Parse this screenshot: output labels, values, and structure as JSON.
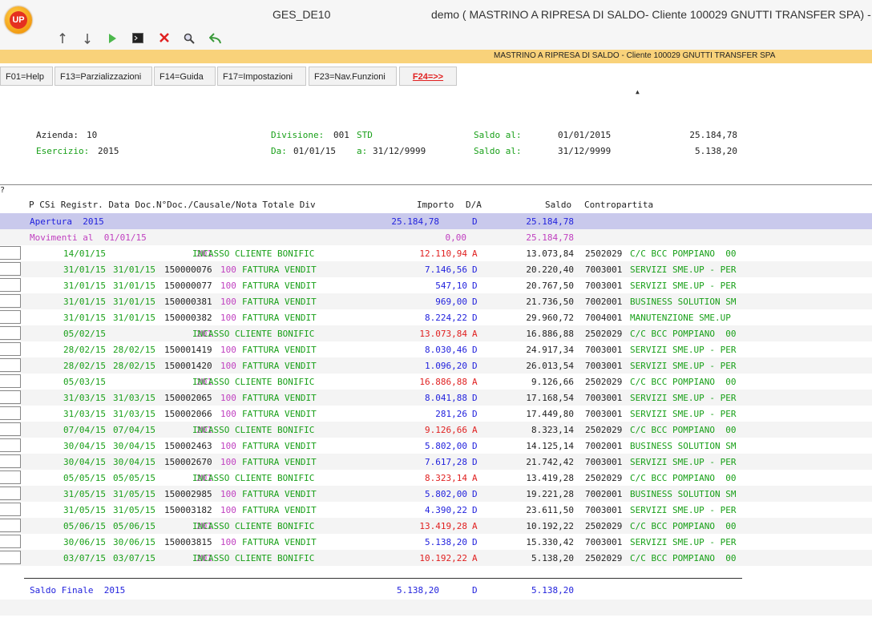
{
  "titlebar": {
    "logo_text": "UP",
    "app_name": "GES_DE10",
    "window_title": "demo ( MASTRINO A RIPRESA DI SALDO- Cliente 100029 GNUTTI TRANSFER SPA) -"
  },
  "toolbar": {
    "icons": [
      "arrow-up-icon",
      "arrow-down-icon",
      "play-icon",
      "terminal-icon",
      "delete-icon",
      "search-icon",
      "back-icon"
    ]
  },
  "subtitle": "MASTRINO A RIPRESA DI SALDO -  Cliente 100029 GNUTTI TRANSFER SPA",
  "fkeys": [
    {
      "label": "F01=Help"
    },
    {
      "label": "F13=Parzializzazioni"
    },
    {
      "label": "F14=Guida"
    },
    {
      "label": "F17=Impostazioni"
    },
    {
      "label": "F23=Nav.Funzioni"
    },
    {
      "label": "F24=>>"
    }
  ],
  "header": {
    "azienda_label": "Azienda:",
    "azienda_value": "10",
    "esercizio_label": "Esercizio:",
    "esercizio_value": "2015",
    "divisione_label": "Divisione:",
    "divisione_value": "001",
    "divisione_desc": "STD",
    "da_label": "Da:",
    "da_value": "01/01/15",
    "a_label": "a:",
    "a_value": "31/12/9999",
    "saldo1_label": "Saldo al:",
    "saldo1_date": "01/01/2015",
    "saldo1_value": "25.184,78",
    "saldo2_label": "Saldo al:",
    "saldo2_date": "31/12/9999",
    "saldo2_value": "5.138,20"
  },
  "table": {
    "qmark": "?",
    "columns": {
      "main": "P CSi Registr. Data Doc.N°Doc./Causale/Nota Totale Div",
      "importo": "Importo",
      "da": "D/A",
      "saldo": "Saldo",
      "contropartita": "Contropartita"
    },
    "apertura": {
      "label": "Apertura  2015",
      "importo": "25.184,78",
      "da": "D",
      "saldo": "25.184,78"
    },
    "movimenti": {
      "label": "Movimenti al  01/01/15",
      "importo": "0,00",
      "saldo": "25.184,78"
    },
    "rows": [
      {
        "reg": "14/01/15",
        "data_doc": "",
        "ndoc": "",
        "caus": "201",
        "desc": "INCASSO CLIENTE BONIFIC",
        "importo": "12.110,94",
        "da": "A",
        "saldo": "13.073,84",
        "conto": "2502029",
        "conto_desc": "C/C BCC POMPIANO  00"
      },
      {
        "reg": "31/01/15",
        "data_doc": "31/01/15",
        "ndoc": "150000076",
        "caus": "100",
        "desc": "FATTURA VENDIT",
        "importo": "7.146,56",
        "da": "D",
        "saldo": "20.220,40",
        "conto": "7003001",
        "conto_desc": "SERVIZI SME.UP - PER"
      },
      {
        "reg": "31/01/15",
        "data_doc": "31/01/15",
        "ndoc": "150000077",
        "caus": "100",
        "desc": "FATTURA VENDIT",
        "importo": "547,10",
        "da": "D",
        "saldo": "20.767,50",
        "conto": "7003001",
        "conto_desc": "SERVIZI SME.UP - PER"
      },
      {
        "reg": "31/01/15",
        "data_doc": "31/01/15",
        "ndoc": "150000381",
        "caus": "100",
        "desc": "FATTURA VENDIT",
        "importo": "969,00",
        "da": "D",
        "saldo": "21.736,50",
        "conto": "7002001",
        "conto_desc": "BUSINESS SOLUTION SM"
      },
      {
        "reg": "31/01/15",
        "data_doc": "31/01/15",
        "ndoc": "150000382",
        "caus": "100",
        "desc": "FATTURA VENDIT",
        "importo": "8.224,22",
        "da": "D",
        "saldo": "29.960,72",
        "conto": "7004001",
        "conto_desc": "MANUTENZIONE SME.UP"
      },
      {
        "reg": "05/02/15",
        "data_doc": "",
        "ndoc": "",
        "caus": "201",
        "desc": "INCASSO CLIENTE BONIFIC",
        "importo": "13.073,84",
        "da": "A",
        "saldo": "16.886,88",
        "conto": "2502029",
        "conto_desc": "C/C BCC POMPIANO  00"
      },
      {
        "reg": "28/02/15",
        "data_doc": "28/02/15",
        "ndoc": "150001419",
        "caus": "100",
        "desc": "FATTURA VENDIT",
        "importo": "8.030,46",
        "da": "D",
        "saldo": "24.917,34",
        "conto": "7003001",
        "conto_desc": "SERVIZI SME.UP - PER"
      },
      {
        "reg": "28/02/15",
        "data_doc": "28/02/15",
        "ndoc": "150001420",
        "caus": "100",
        "desc": "FATTURA VENDIT",
        "importo": "1.096,20",
        "da": "D",
        "saldo": "26.013,54",
        "conto": "7003001",
        "conto_desc": "SERVIZI SME.UP - PER"
      },
      {
        "reg": "05/03/15",
        "data_doc": "",
        "ndoc": "",
        "caus": "201",
        "desc": "INCASSO CLIENTE BONIFIC",
        "importo": "16.886,88",
        "da": "A",
        "saldo": "9.126,66",
        "conto": "2502029",
        "conto_desc": "C/C BCC POMPIANO  00"
      },
      {
        "reg": "31/03/15",
        "data_doc": "31/03/15",
        "ndoc": "150002065",
        "caus": "100",
        "desc": "FATTURA VENDIT",
        "importo": "8.041,88",
        "da": "D",
        "saldo": "17.168,54",
        "conto": "7003001",
        "conto_desc": "SERVIZI SME.UP - PER"
      },
      {
        "reg": "31/03/15",
        "data_doc": "31/03/15",
        "ndoc": "150002066",
        "caus": "100",
        "desc": "FATTURA VENDIT",
        "importo": "281,26",
        "da": "D",
        "saldo": "17.449,80",
        "conto": "7003001",
        "conto_desc": "SERVIZI SME.UP - PER"
      },
      {
        "reg": "07/04/15",
        "data_doc": "07/04/15",
        "ndoc": "",
        "caus": "201",
        "desc": "INCASSO CLIENTE BONIFIC",
        "importo": "9.126,66",
        "da": "A",
        "saldo": "8.323,14",
        "conto": "2502029",
        "conto_desc": "C/C BCC POMPIANO  00"
      },
      {
        "reg": "30/04/15",
        "data_doc": "30/04/15",
        "ndoc": "150002463",
        "caus": "100",
        "desc": "FATTURA VENDIT",
        "importo": "5.802,00",
        "da": "D",
        "saldo": "14.125,14",
        "conto": "7002001",
        "conto_desc": "BUSINESS SOLUTION SM"
      },
      {
        "reg": "30/04/15",
        "data_doc": "30/04/15",
        "ndoc": "150002670",
        "caus": "100",
        "desc": "FATTURA VENDIT",
        "importo": "7.617,28",
        "da": "D",
        "saldo": "21.742,42",
        "conto": "7003001",
        "conto_desc": "SERVIZI SME.UP - PER"
      },
      {
        "reg": "05/05/15",
        "data_doc": "05/05/15",
        "ndoc": "",
        "caus": "201",
        "desc": "INCASSO CLIENTE BONIFIC",
        "importo": "8.323,14",
        "da": "A",
        "saldo": "13.419,28",
        "conto": "2502029",
        "conto_desc": "C/C BCC POMPIANO  00"
      },
      {
        "reg": "31/05/15",
        "data_doc": "31/05/15",
        "ndoc": "150002985",
        "caus": "100",
        "desc": "FATTURA VENDIT",
        "importo": "5.802,00",
        "da": "D",
        "saldo": "19.221,28",
        "conto": "7002001",
        "conto_desc": "BUSINESS SOLUTION SM"
      },
      {
        "reg": "31/05/15",
        "data_doc": "31/05/15",
        "ndoc": "150003182",
        "caus": "100",
        "desc": "FATTURA VENDIT",
        "importo": "4.390,22",
        "da": "D",
        "saldo": "23.611,50",
        "conto": "7003001",
        "conto_desc": "SERVIZI SME.UP - PER"
      },
      {
        "reg": "05/06/15",
        "data_doc": "05/06/15",
        "ndoc": "",
        "caus": "201",
        "desc": "INCASSO CLIENTE BONIFIC",
        "importo": "13.419,28",
        "da": "A",
        "saldo": "10.192,22",
        "conto": "2502029",
        "conto_desc": "C/C BCC POMPIANO  00"
      },
      {
        "reg": "30/06/15",
        "data_doc": "30/06/15",
        "ndoc": "150003815",
        "caus": "100",
        "desc": "FATTURA VENDIT",
        "importo": "5.138,20",
        "da": "D",
        "saldo": "15.330,42",
        "conto": "7003001",
        "conto_desc": "SERVIZI SME.UP - PER"
      },
      {
        "reg": "03/07/15",
        "data_doc": "03/07/15",
        "ndoc": "",
        "caus": "201",
        "desc": "INCASSO CLIENTE BONIFIC",
        "importo": "10.192,22",
        "da": "A",
        "saldo": "5.138,20",
        "conto": "2502029",
        "conto_desc": "C/C BCC POMPIANO  00"
      }
    ],
    "saldo_finale": {
      "label": "Saldo Finale  2015",
      "importo": "5.138,20",
      "da": "D",
      "saldo": "5.138,20"
    }
  },
  "colors": {
    "subtitle_band": "#f9d27a",
    "apertura_row": "#c9c9ec",
    "green_text": "#19a019",
    "blue_text": "#2222dd",
    "red_text": "#e02020",
    "purple_text": "#c040c0"
  }
}
